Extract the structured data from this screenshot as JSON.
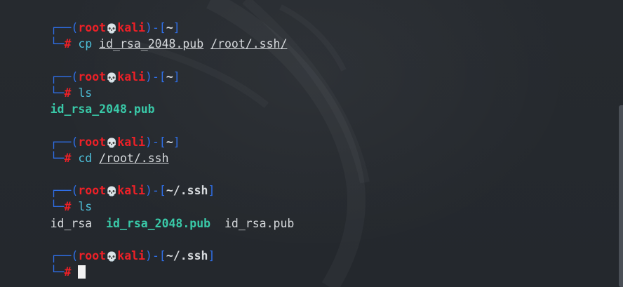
{
  "prompt": {
    "open": "┌──(",
    "user": "root",
    "skull_icon": "💀",
    "host": "kali",
    "mid": ")-[",
    "close": "]",
    "second": "└─",
    "hash": "#"
  },
  "blocks": [
    {
      "cwd": "~",
      "cmd": "cp",
      "args": [
        "id_rsa_2048.pub",
        "/root/.ssh/"
      ]
    },
    {
      "cwd": "~",
      "cmd": "ls",
      "output": [
        {
          "text": "id_rsa_2048.pub",
          "type": "green"
        }
      ]
    },
    {
      "cwd": "~",
      "cmd": "cd",
      "args": [
        "/root/.ssh"
      ]
    },
    {
      "cwd": "~/.ssh",
      "cmd": "ls",
      "output": [
        {
          "text": "id_rsa",
          "type": "plain"
        },
        {
          "text": "id_rsa_2048.pub",
          "type": "green"
        },
        {
          "text": "id_rsa.pub",
          "type": "plain"
        }
      ]
    },
    {
      "cwd": "~/.ssh",
      "cmd": "",
      "cursor": true
    }
  ],
  "colors": {
    "background": "#25292e",
    "prompt_box": "#2f6fe8",
    "prompt_red": "#ee2027",
    "command": "#4dbfd9",
    "green_file": "#39c9a8"
  }
}
